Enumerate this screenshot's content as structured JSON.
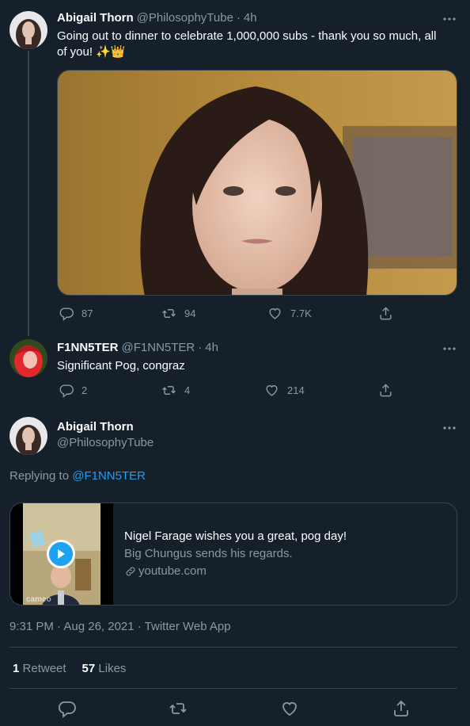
{
  "tweet1": {
    "name": "Abigail Thorn",
    "handle": "@PhilosophyTube",
    "time": "4h",
    "text_line1": "Going out to dinner to celebrate 1,000,000 subs - thank you so much, all",
    "text_line2": "of you! ✨👑",
    "replies": "87",
    "retweets": "94",
    "likes": "7.7K"
  },
  "tweet2": {
    "name": "F1NN5TER",
    "handle": "@F1NN5TER",
    "time": "4h",
    "text": "Significant Pog, congraz",
    "replies": "2",
    "retweets": "4",
    "likes": "214"
  },
  "main": {
    "name": "Abigail Thorn",
    "handle": "@PhilosophyTube",
    "replying_prefix": "Replying to",
    "replying_to": "@F1NN5TER",
    "card": {
      "title": "Nigel Farage wishes you a great, pog day!",
      "description": "Big Chungus sends his regards.",
      "domain": "youtube.com",
      "thumb_brand": "cameo"
    },
    "timestamp": "9:31 PM · Aug 26, 2021 · Twitter Web App",
    "retweet_count": "1",
    "retweet_label": "Retweet",
    "likes_count": "57",
    "likes_label": "Likes"
  },
  "colors": {
    "background": "#15202b",
    "secondary_text": "#8899a6",
    "link": "#1da1f2",
    "border": "#38444d"
  }
}
